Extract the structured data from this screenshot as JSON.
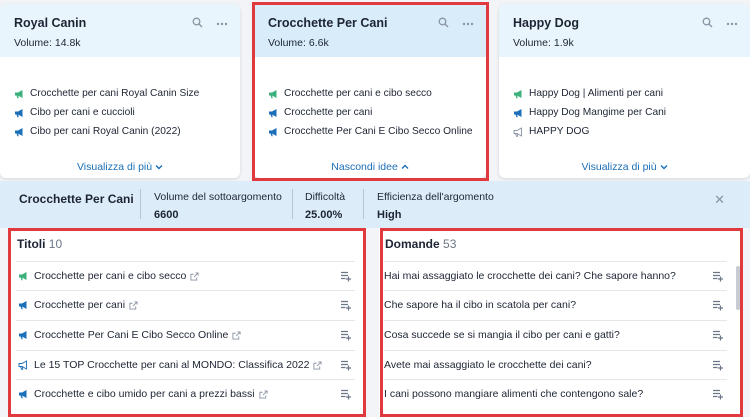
{
  "cards": [
    {
      "title": "Royal Canin",
      "volume": "Volume: 14.8k",
      "items": [
        {
          "text": "Crocchette per cani Royal Canin Size",
          "icon": "megaphone-green-icon"
        },
        {
          "text": "Cibo per cani e cuccioli",
          "icon": "megaphone-blue-icon"
        },
        {
          "text": "Cibo per cani Royal Canin (2022)",
          "icon": "megaphone-blue-icon"
        }
      ],
      "footer": "Visualizza di più"
    },
    {
      "title": "Crocchette Per Cani",
      "volume": "Volume: 6.6k",
      "items": [
        {
          "text": "Crocchette per cani e cibo secco",
          "icon": "megaphone-green-icon"
        },
        {
          "text": "Crocchette per cani",
          "icon": "megaphone-blue-icon"
        },
        {
          "text": "Crocchette Per Cani E Cibo Secco Online",
          "icon": "megaphone-blue-icon"
        }
      ],
      "footer": "Nascondi idee"
    },
    {
      "title": "Happy Dog",
      "volume": "Volume: 1.9k",
      "items": [
        {
          "text": "Happy Dog | Alimenti per cani",
          "icon": "megaphone-green-icon"
        },
        {
          "text": "Happy Dog Mangime per Cani",
          "icon": "megaphone-blue-icon"
        },
        {
          "text": "HAPPY DOG",
          "icon": "megaphone-outline-icon"
        }
      ],
      "footer": "Visualizza di più"
    }
  ],
  "topic": {
    "title": "Crocchette Per Cani",
    "subtopic_volume_label": "Volume del sottoargomento",
    "subtopic_volume_value": "6600",
    "difficulty_label": "Difficoltà",
    "difficulty_value": "25.00%",
    "efficiency_label": "Efficienza dell'argomento",
    "efficiency_value": "High"
  },
  "titles_panel": {
    "label": "Titoli",
    "count": "10",
    "rows": [
      {
        "text": "Crocchette per cani e cibo secco",
        "icon": "megaphone-green-icon"
      },
      {
        "text": "Crocchette per cani",
        "icon": "megaphone-blue-icon"
      },
      {
        "text": "Crocchette Per Cani E Cibo Secco Online",
        "icon": "megaphone-blue-icon"
      },
      {
        "text": "Le 15 TOP Crocchette per cani al MONDO: Classifica 2022",
        "icon": "megaphone-outline-icon"
      },
      {
        "text": "Crocchette e cibo umido per cani a prezzi bassi",
        "icon": "megaphone-blue-icon"
      }
    ]
  },
  "questions_panel": {
    "label": "Domande",
    "count": "53",
    "rows": [
      {
        "text": "Hai mai assaggiato le crocchette dei cani? Che sapore hanno?"
      },
      {
        "text": "Che sapore ha il cibo in scatola per cani?"
      },
      {
        "text": "Cosa succede se si mangia il cibo per cani e gatti?"
      },
      {
        "text": "Avete mai assaggiato le crocchette dei cani?"
      },
      {
        "text": "I cani possono mangiare alimenti che contengono sale?"
      }
    ]
  },
  "colors": {
    "accent_blue": "#1b6fb8",
    "green_icon": "#3bb07a",
    "highlight_red": "#e0393e"
  }
}
